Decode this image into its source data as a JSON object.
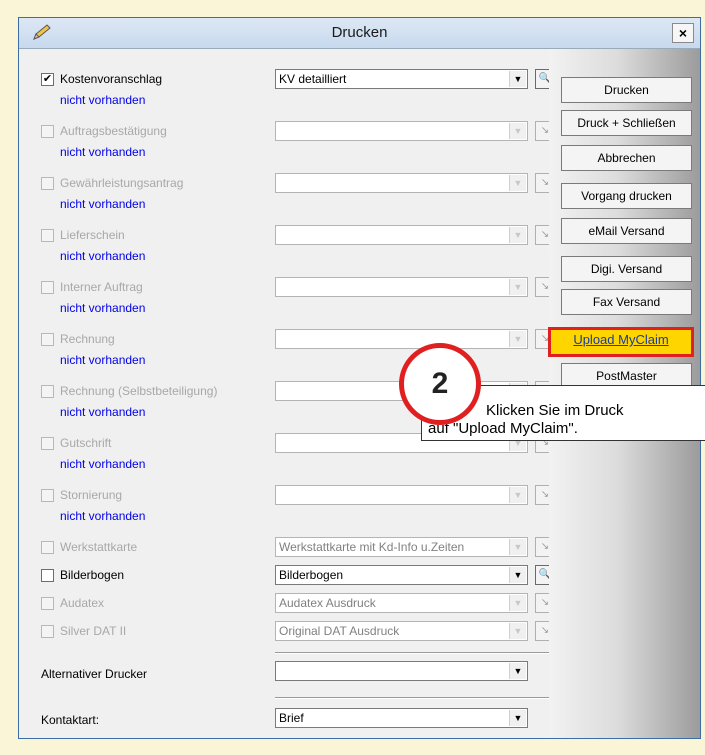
{
  "dialog": {
    "title": "Drucken",
    "close_label": "×"
  },
  "rows": [
    {
      "label": "Kostenvoranschlag",
      "checked": "✔",
      "status": "nicht vorhanden",
      "combo": "KV detailliert"
    },
    {
      "label": "Auftragsbestätigung",
      "checked": "",
      "status": "nicht vorhanden",
      "combo": ""
    },
    {
      "label": "Gewährleistungsantrag",
      "checked": "",
      "status": "nicht vorhanden",
      "combo": ""
    },
    {
      "label": "Lieferschein",
      "checked": "",
      "status": "nicht vorhanden",
      "combo": ""
    },
    {
      "label": "Interner Auftrag",
      "checked": "",
      "status": "nicht vorhanden",
      "combo": ""
    },
    {
      "label": "Rechnung",
      "checked": "",
      "status": "nicht vorhanden",
      "combo": ""
    },
    {
      "label": "Rechnung (Selbstbeteiligung)",
      "checked": "",
      "status": "nicht vorhanden",
      "combo": ""
    },
    {
      "label": "Gutschrift",
      "checked": "",
      "status": "nicht vorhanden",
      "combo": ""
    },
    {
      "label": "Stornierung",
      "checked": "",
      "status": "nicht vorhanden",
      "combo": ""
    },
    {
      "label": "Werkstattkarte",
      "checked": "",
      "combo": "Werkstattkarte mit Kd-Info u.Zeiten"
    },
    {
      "label": "Bilderbogen",
      "checked": "",
      "combo": "Bilderbogen"
    },
    {
      "label": "Audatex",
      "checked": "",
      "combo": "Audatex Ausdruck"
    },
    {
      "label": "Silver DAT II",
      "checked": "",
      "combo": "Original DAT Ausdruck"
    }
  ],
  "alt_printer": {
    "label": "Alternativer Drucker",
    "value": ""
  },
  "contact": {
    "label": "Kontaktart:",
    "value": "Brief"
  },
  "buttons": {
    "print": "Drucken",
    "print_close": "Druck + Schließen",
    "cancel": "Abbrechen",
    "print_process": "Vorgang drucken",
    "email": "eMail Versand",
    "digi": "Digi. Versand",
    "fax": "Fax Versand",
    "upload": "Upload MyClaim",
    "postmaster": "PostMaster"
  },
  "callout": {
    "step": "2",
    "line1": "Klicken Sie im Druck",
    "line2": "auf \"Upload MyClaim\"."
  },
  "icons": {
    "search": "search-icon",
    "pencil": "pencil-icon",
    "dropdown": "dropdown-arrow-icon"
  },
  "colors": {
    "highlight": "#ffd500",
    "callout_border": "#e02020",
    "link": "#0000ee"
  }
}
